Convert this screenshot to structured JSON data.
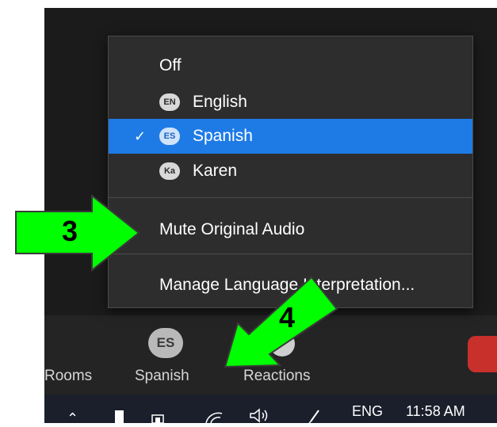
{
  "menu": {
    "items": [
      {
        "label": "Off"
      },
      {
        "label": "English",
        "badge": "EN"
      },
      {
        "label": "Spanish",
        "badge": "ES",
        "selected": true,
        "check": "✓"
      },
      {
        "label": "Karen",
        "badge": "Ka"
      }
    ],
    "mute_label": "Mute Original Audio",
    "manage_label": "Manage Language Interpretation..."
  },
  "toolbar": {
    "rooms_label": "Rooms",
    "language_badge": "ES",
    "language_label": "Spanish",
    "reactions_label": "Reactions"
  },
  "taskbar": {
    "language": "ENG",
    "time": "11:58 AM"
  },
  "annotations": {
    "arrow3": "3",
    "arrow4": "4",
    "arrow_color": "#00ff00"
  },
  "colors": {
    "menu_bg": "#2d2d2d",
    "selected_bg": "#1e7be6",
    "end_button": "#c8302b"
  }
}
